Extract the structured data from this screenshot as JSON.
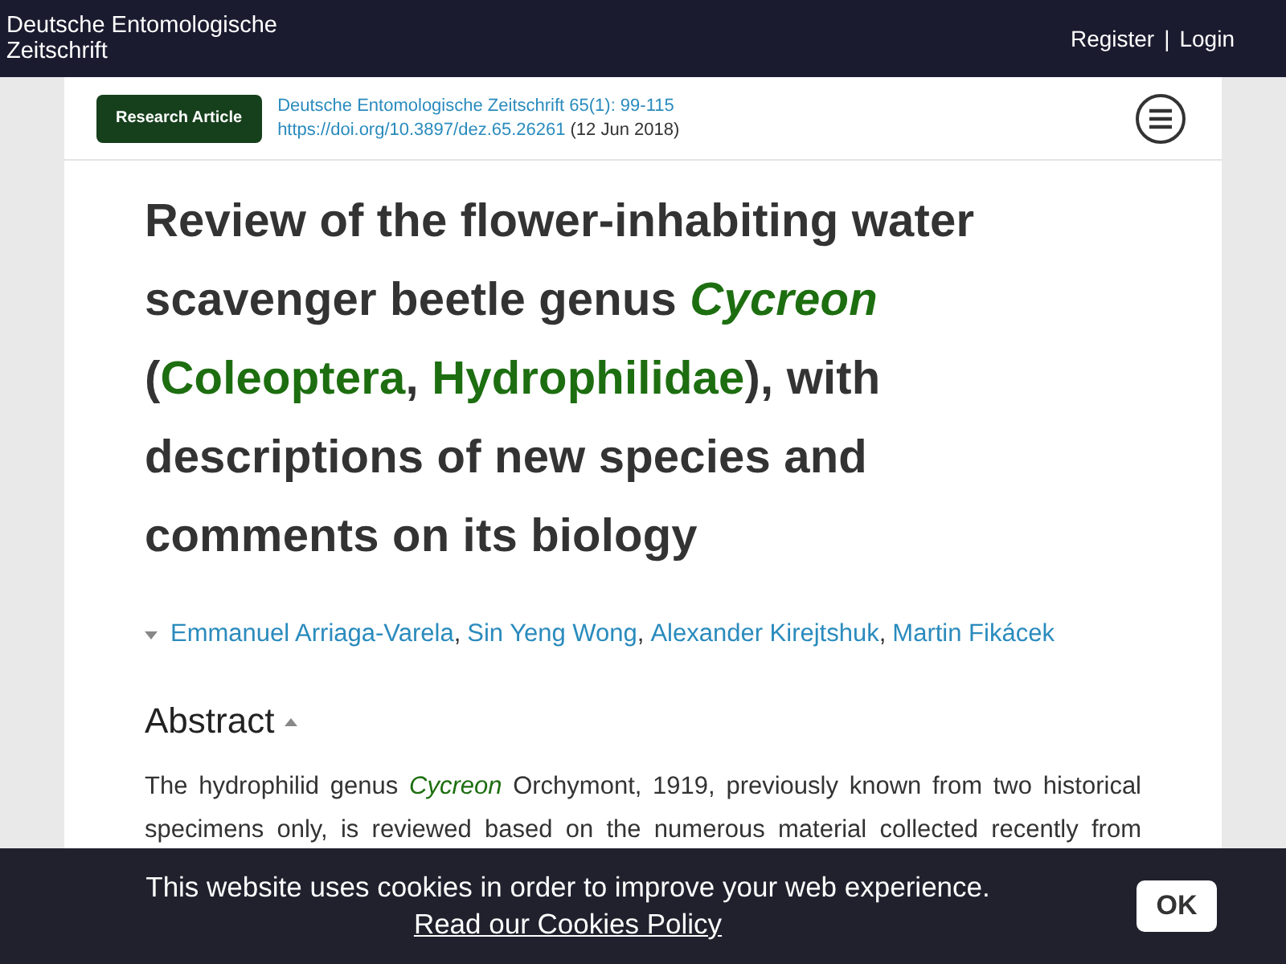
{
  "header": {
    "site_title": "Deutsche Entomologische Zeitschrift",
    "links": [
      {
        "label": "Register"
      },
      {
        "label": "Login"
      }
    ],
    "separator": "|"
  },
  "article_bar": {
    "badge": "Research Article",
    "journal": "Deutsche Entomologische Zeitschrift 65(1): 99-115",
    "doi": "https://doi.org/10.3897/dez.65.26261",
    "date": "(12 Jun 2018)"
  },
  "title": [
    {
      "kind": "plain",
      "text": "Review of the flower-inhabiting water scavenger beetle genus "
    },
    {
      "kind": "genus",
      "text": "Cycreon"
    },
    {
      "kind": "plain",
      "text": " ("
    },
    {
      "kind": "taxon",
      "text": "Coleoptera"
    },
    {
      "kind": "plain",
      "text": ", "
    },
    {
      "kind": "taxon",
      "text": "Hydrophilidae"
    },
    {
      "kind": "plain",
      "text": "), with descriptions of new species and comments on its biology"
    }
  ],
  "authors": {
    "expanded": false,
    "separator": ",",
    "names": [
      "Emmanuel Arriaga-Varela",
      "Sin Yeng Wong",
      "Alexander Kirejtshuk",
      "Martin Fikácek"
    ]
  },
  "abstract": {
    "heading": "Abstract",
    "expanded": true,
    "text": [
      {
        "kind": "plain",
        "text": "The hydrophilid genus "
      },
      {
        "kind": "genus",
        "text": "Cycreon"
      },
      {
        "kind": "plain",
        "text": " Orchymont, 1919, previously known from two historical specimens only, is reviewed based on the numerous material collected recently from"
      }
    ]
  },
  "cookie_banner": {
    "message": "This website uses cookies in order to improve your web experience.",
    "link": "Read our Cookies Policy",
    "button": "OK"
  }
}
